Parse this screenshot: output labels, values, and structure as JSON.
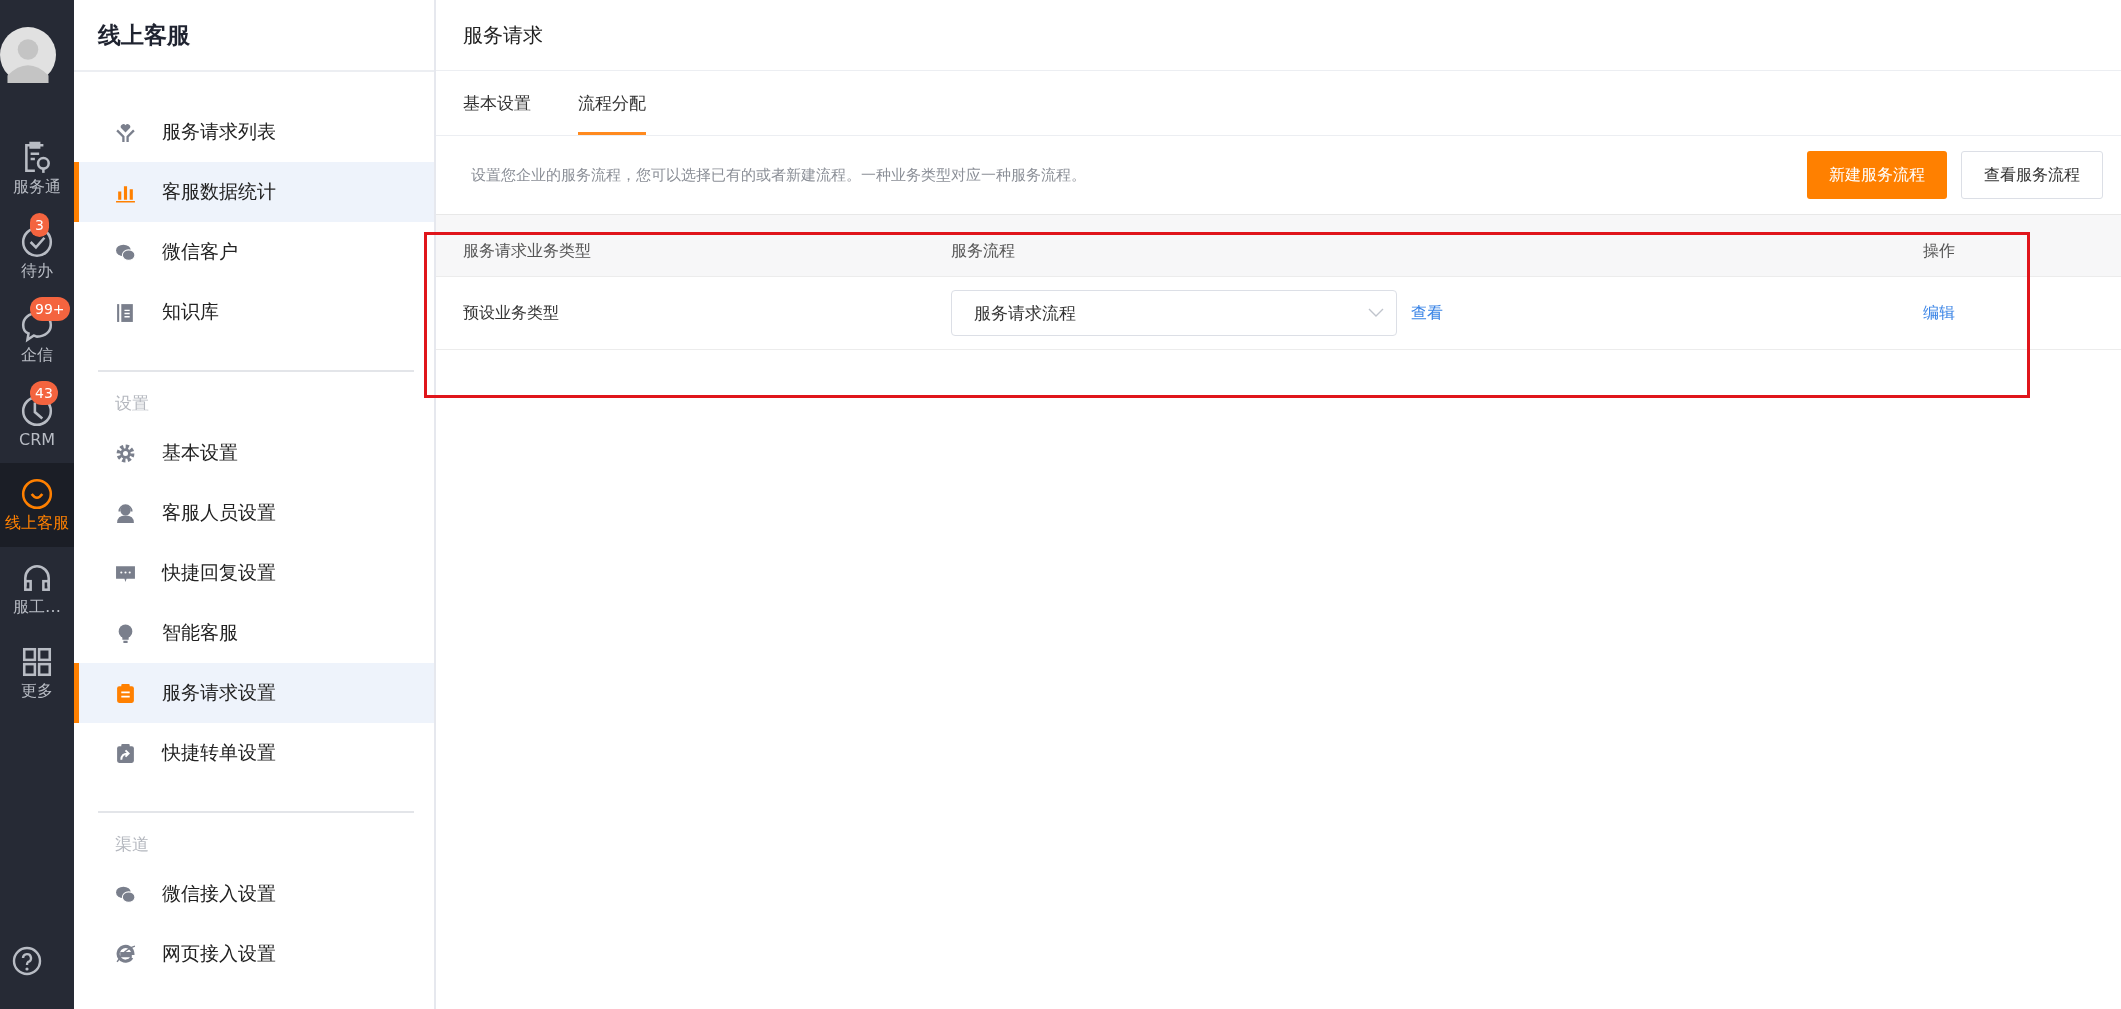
{
  "nav_rail": {
    "items": [
      {
        "label": "服务通",
        "selected": false
      },
      {
        "label": "待办",
        "badge": "3",
        "selected": false
      },
      {
        "label": "企信",
        "badge": "99+",
        "selected": false
      },
      {
        "label": "CRM",
        "badge": "43",
        "selected": false
      },
      {
        "label": "线上客服",
        "selected": true
      },
      {
        "label": "服工…",
        "selected": false
      },
      {
        "label": "更多",
        "selected": false
      }
    ]
  },
  "sidebar": {
    "title": "线上客服",
    "sections": [
      {
        "items": [
          {
            "label": "服务请求列表",
            "selected": false
          },
          {
            "label": "客服数据统计",
            "selected": true
          },
          {
            "label": "微信客户",
            "selected": false
          },
          {
            "label": "知识库",
            "selected": false
          }
        ]
      },
      {
        "heading": "设置",
        "items": [
          {
            "label": "基本设置",
            "selected": false
          },
          {
            "label": "客服人员设置",
            "selected": false
          },
          {
            "label": "快捷回复设置",
            "selected": false
          },
          {
            "label": "智能客服",
            "selected": false
          },
          {
            "label": "服务请求设置",
            "selected": true
          },
          {
            "label": "快捷转单设置",
            "selected": false
          }
        ]
      },
      {
        "heading": "渠道",
        "items": [
          {
            "label": "微信接入设置",
            "selected": false
          },
          {
            "label": "网页接入设置",
            "selected": false
          }
        ]
      }
    ]
  },
  "main": {
    "title": "服务请求",
    "tabs": [
      {
        "label": "基本设置",
        "selected": false
      },
      {
        "label": "流程分配",
        "selected": true
      }
    ],
    "description": "设置您企业的服务流程，您可以选择已有的或者新建流程。一种业务类型对应一种服务流程。",
    "buttons": [
      {
        "label": "新建服务流程",
        "kind": "primary"
      },
      {
        "label": "查看服务流程",
        "kind": "default"
      }
    ],
    "table": {
      "columns": [
        "服务请求业务类型",
        "服务流程",
        "操作"
      ],
      "rows": [
        {
          "type": "预设业务类型",
          "flow": "服务请求流程",
          "view_link": "查看",
          "action": "编辑"
        }
      ]
    }
  }
}
